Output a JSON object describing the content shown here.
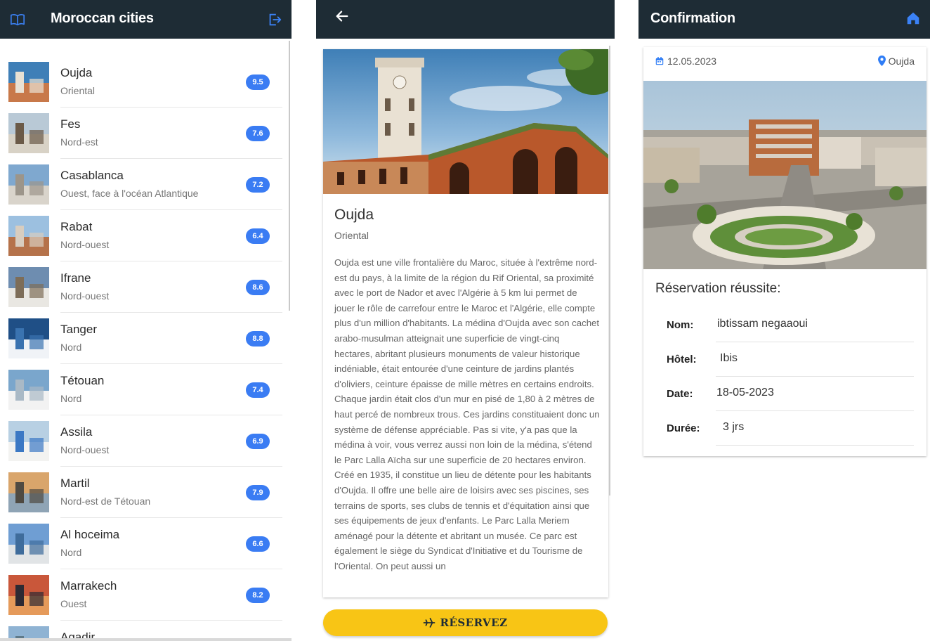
{
  "list_screen": {
    "title": "Moroccan cities",
    "cities": [
      {
        "name": "Oujda",
        "region": "Oriental",
        "rating": "9.5"
      },
      {
        "name": "Fes",
        "region": "Nord-est",
        "rating": "7.6"
      },
      {
        "name": "Casablanca",
        "region": "Ouest, face à l'océan Atlantique",
        "rating": "7.2"
      },
      {
        "name": "Rabat",
        "region": "Nord-ouest",
        "rating": "6.4"
      },
      {
        "name": "Ifrane",
        "region": "Nord-ouest",
        "rating": "8.6"
      },
      {
        "name": "Tanger",
        "region": "Nord",
        "rating": "8.8"
      },
      {
        "name": "Tétouan",
        "region": "Nord",
        "rating": "7.4"
      },
      {
        "name": "Assila",
        "region": "Nord-ouest",
        "rating": "6.9"
      },
      {
        "name": "Martil",
        "region": "Nord-est de Tétouan",
        "rating": "7.9"
      },
      {
        "name": "Al hoceima",
        "region": "Nord",
        "rating": "6.6"
      },
      {
        "name": "Marrakech",
        "region": "Ouest",
        "rating": "8.2"
      },
      {
        "name": "Agadir",
        "region": "",
        "rating": ""
      }
    ]
  },
  "detail_screen": {
    "name": "Oujda",
    "region": "Oriental",
    "description": "Oujda est une ville frontalière du Maroc, située à l'extrême nord-est du pays, à la limite de la région du Rif Oriental, sa proximité avec le port de Nador et avec l'Algérie à 5 km lui permet de jouer le rôle de carrefour entre le Maroc et l'Algérie, elle compte plus d'un million d'habitants. La médina d'Oujda avec son cachet arabo-musulman atteignait une superficie de vingt-cinq hectares, abritant plusieurs monuments de valeur historique indéniable, était entourée d'une ceinture de jardins plantés d'oliviers, ceinture épaisse de mille mètres en certains endroits. Chaque jardin était clos d'un mur en pisé de 1,80 à 2 mètres de haut percé de nombreux trous. Ces jardins constituaient donc un système de défense appréciable. Pas si vite, y'a pas que la médina à voir, vous verrez aussi non loin de la médina, s'étend le Parc Lalla Aïcha sur une superficie de 20 hectares environ. Créé en 1935, il constitue un lieu de détente pour les habitants d'Oujda. Il offre une belle aire de loisirs avec ses piscines, ses terrains de sports, ses clubs de tennis et d'équitation ainsi que ses équipements de jeux d'enfants. Le Parc Lalla Meriem aménagé pour la détente et abritant un musée. Ce parc est également le siège du Syndicat d'Initiative et du Tourisme de l'Oriental. On peut aussi un",
    "reserve_label": "RÉSERVEZ"
  },
  "confirmation_screen": {
    "title": "Confirmation",
    "date": "12.05.2023",
    "location": "Oujda",
    "heading": "Réservation réussite:",
    "fields": [
      {
        "label": "Nom:",
        "value": "ibtissam negaaoui"
      },
      {
        "label": "Hôtel:",
        "value": "Ibis"
      },
      {
        "label": "Date:",
        "value": "18-05-2023"
      },
      {
        "label": "Durée:",
        "value": "3 jrs"
      }
    ]
  },
  "colors": {
    "topbar": "#1e2c35",
    "badge": "#3a7cf3",
    "icon_blue": "#2f7df6",
    "reserve_button": "#f8c515"
  },
  "icons": {
    "list_header_left": "book-open-icon",
    "list_header_right": "logout-icon",
    "detail_header_left": "arrow-left-icon",
    "confirmation_header_right": "home-icon",
    "date": "calendar-icon",
    "location": "map-pin-icon",
    "reserve": "airplane-icon"
  }
}
